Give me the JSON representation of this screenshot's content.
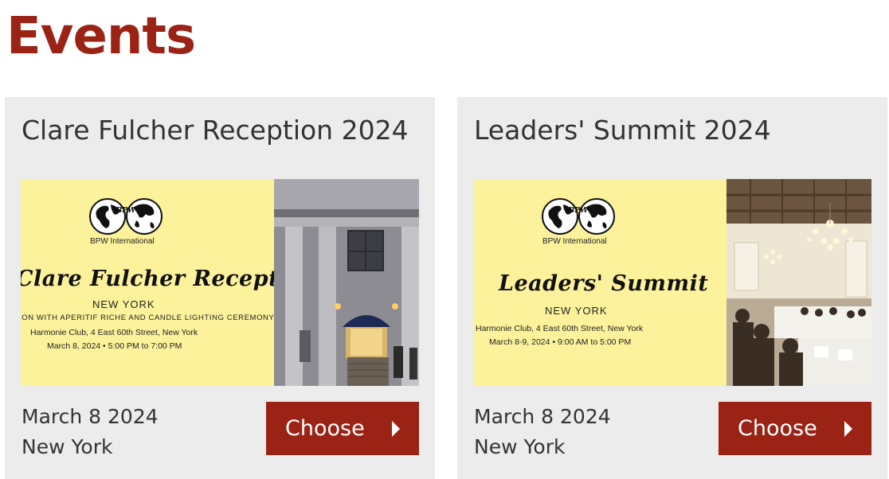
{
  "page_title": "Events",
  "colors": {
    "brand": "#9b2316",
    "card_bg": "#ececec",
    "banner_yellow": "#fcf29c"
  },
  "events": [
    {
      "title": "Clare Fulcher Reception 2024",
      "banner": {
        "org": "BPW International",
        "logo_text": "BPW",
        "headline": "Clare Fulcher Reception",
        "city": "NEW YORK",
        "subline": "ION WITH APERITIF RICHE AND CANDLE LIGHTING CEREMONY",
        "venue": "Harmonie Club, 4 East 60th Street, New York",
        "datetime": "March 8, 2024  •  5:00 PM to 7:00 PM",
        "photo": "harmonie-club-facade"
      },
      "date": "March 8 2024",
      "location": "New York",
      "button_label": "Choose"
    },
    {
      "title": "Leaders' Summit 2024",
      "banner": {
        "org": "BPW International",
        "logo_text": "BPW",
        "headline": "Leaders' Summit",
        "city": "NEW YORK",
        "venue": "Harmonie Club, 4 East 60th Street, New York",
        "datetime": "March 8-9, 2024  •  9:00 AM to 5:00 PM",
        "photo": "banquet-hall-chandelier"
      },
      "date": "March 8 2024",
      "location": "New York",
      "button_label": "Choose"
    }
  ]
}
